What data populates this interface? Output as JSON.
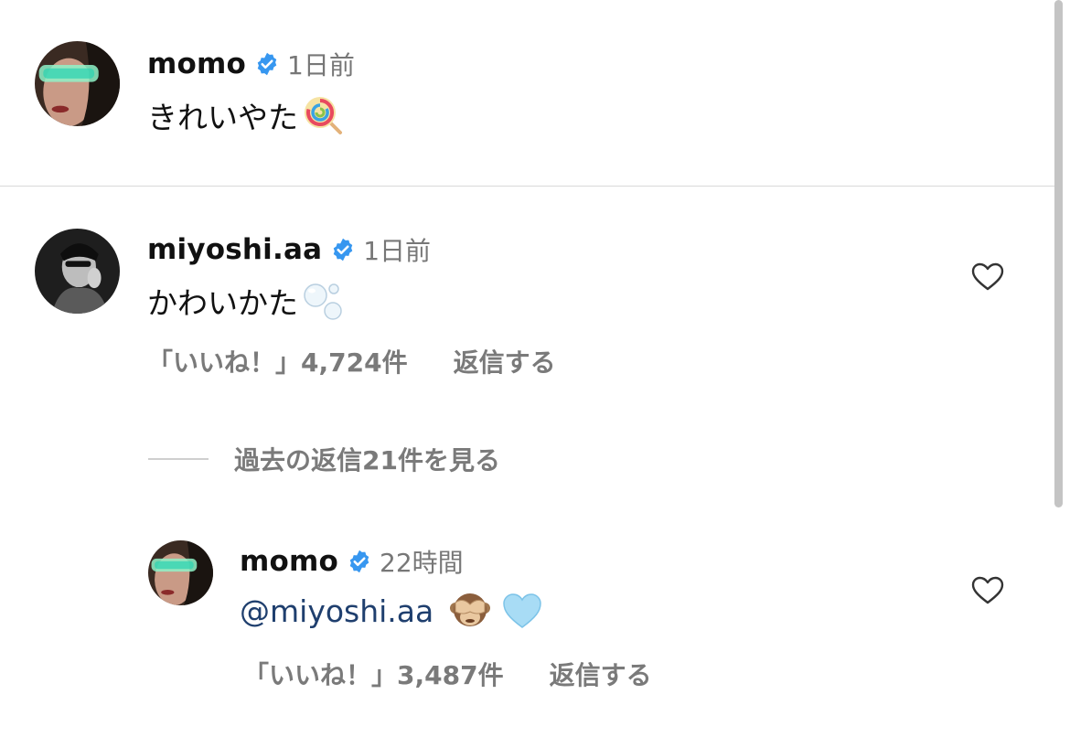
{
  "post": {
    "username": "momo",
    "timestamp": "1日前",
    "text": "きれいやた",
    "emoji": "lollipop"
  },
  "comments": [
    {
      "username": "miyoshi.aa",
      "timestamp": "1日前",
      "text": "かわいかた",
      "emoji": "bubbles",
      "likes_label": "「いいね！」4,724件",
      "reply_label": "返信する"
    }
  ],
  "view_replies_label": "過去の返信21件を見る",
  "reply": {
    "username": "momo",
    "timestamp": "22時間",
    "mention": "@miyoshi.aa",
    "emojis": [
      "see-no-evil-monkey",
      "light-blue-heart"
    ],
    "likes_label": "「いいね！」3,487件",
    "reply_label": "返信する"
  },
  "colors": {
    "verified": "#3797f0",
    "mention": "#1f3f6e",
    "meta_text": "#7a7a7a"
  }
}
